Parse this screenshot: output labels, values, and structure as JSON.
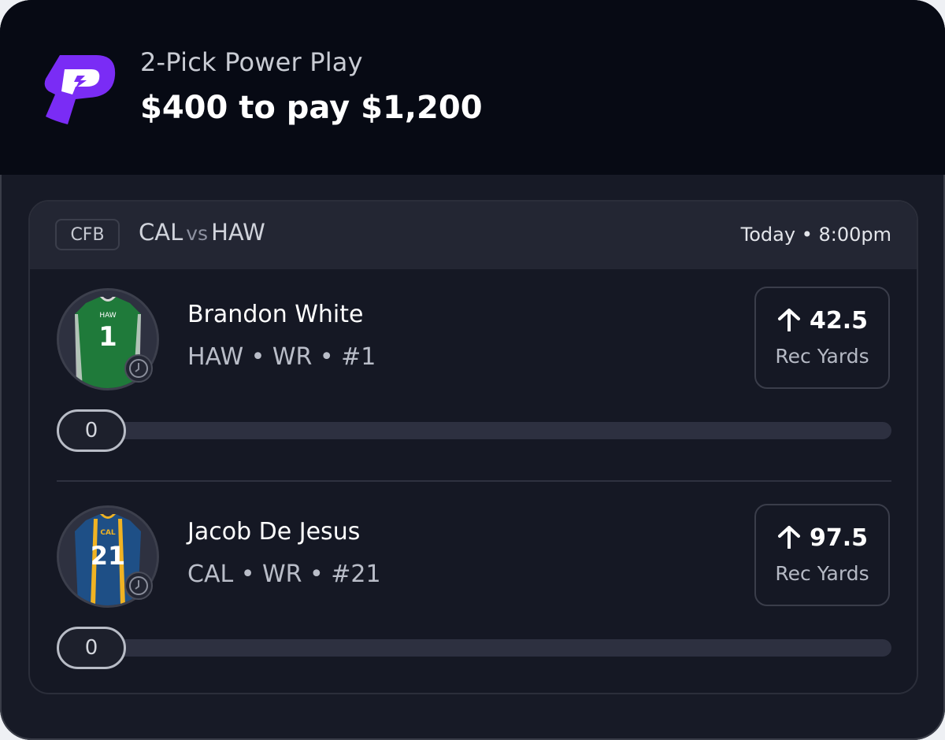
{
  "header": {
    "title": "2-Pick Power Play",
    "amount": "$400 to pay $1,200",
    "brand_color": "#7a2cf5"
  },
  "game": {
    "league": "CFB",
    "team_a": "CAL",
    "vs": "vs",
    "team_b": "HAW",
    "time": "Today • 8:00pm"
  },
  "picks": [
    {
      "name": "Brandon White",
      "info": "HAW • WR • #1",
      "jersey_text": "HAW",
      "jersey_number": "1",
      "jersey_color": "#1f7a3a",
      "direction": "up-arrow-icon",
      "line": "42.5",
      "stat": "Rec Yards",
      "current": "0"
    },
    {
      "name": "Jacob De Jesus",
      "info": "CAL • WR • #21",
      "jersey_text": "CAL",
      "jersey_number": "21",
      "jersey_color": "#1e4f86",
      "direction": "up-arrow-icon",
      "line": "97.5",
      "stat": "Rec Yards",
      "current": "0"
    }
  ]
}
